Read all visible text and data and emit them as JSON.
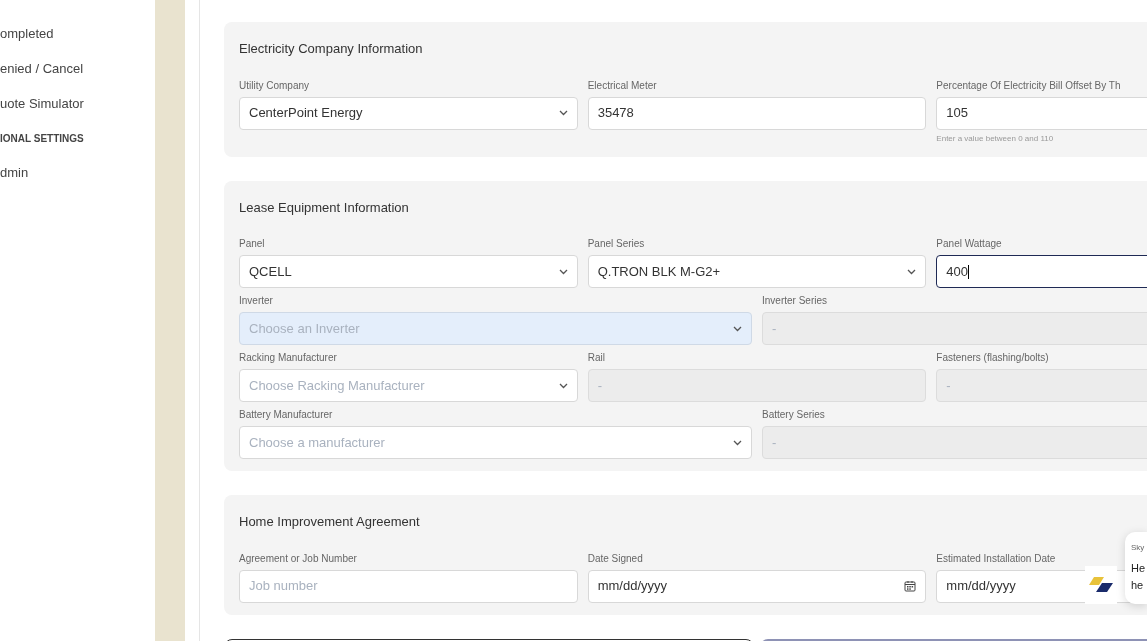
{
  "sidebar": {
    "items": [
      {
        "kind": "item",
        "label": "ompleted"
      },
      {
        "kind": "item",
        "label": "enied / Cancel"
      },
      {
        "kind": "item",
        "label": "uote Simulator"
      },
      {
        "kind": "heading",
        "label": "IONAL SETTINGS"
      },
      {
        "kind": "item",
        "label": "dmin"
      }
    ]
  },
  "sections": [
    {
      "title": "Electricity Company Information",
      "rows": [
        [
          {
            "label": "Utility Company",
            "kind": "select",
            "value": "CenterPoint Energy"
          },
          {
            "label": "Electrical Meter",
            "kind": "text",
            "value": "35478"
          },
          {
            "label": "Percentage Of Electricity Bill Offset By Th",
            "kind": "text",
            "value": "105",
            "hint": "Enter a value between 0 and 110"
          }
        ]
      ]
    },
    {
      "title": "Lease Equipment Information",
      "rows": [
        [
          {
            "label": "Panel",
            "kind": "select",
            "value": "QCELL"
          },
          {
            "label": "Panel Series",
            "kind": "select",
            "value": "Q.TRON BLK M-G2+"
          },
          {
            "label": "Panel Wattage",
            "kind": "text",
            "value": "400",
            "focused": true
          }
        ],
        [
          {
            "label": "Inverter",
            "kind": "select",
            "placeholder": "Choose an Inverter",
            "hovered": true
          },
          {
            "label": "Inverter Series",
            "kind": "readonly",
            "placeholder": "-"
          }
        ],
        [
          {
            "label": "Racking Manufacturer",
            "kind": "select",
            "placeholder": "Choose Racking Manufacturer"
          },
          {
            "label": "Rail",
            "kind": "readonly",
            "placeholder": "-"
          },
          {
            "label": "Fasteners (flashing/bolts)",
            "kind": "readonly",
            "placeholder": "-"
          }
        ],
        [
          {
            "label": "Battery Manufacturer",
            "kind": "select",
            "placeholder": "Choose a manufacturer"
          },
          {
            "label": "Battery Series",
            "kind": "readonly",
            "placeholder": "-"
          }
        ]
      ]
    },
    {
      "title": "Home Improvement Agreement",
      "rows": [
        [
          {
            "label": "Agreement or Job Number",
            "kind": "text",
            "placeholder": "Job number"
          },
          {
            "label": "Date Signed",
            "kind": "date",
            "value": "mm/dd/yyyy"
          },
          {
            "label": "Estimated Installation Date",
            "kind": "date",
            "value": "mm/dd/yyyy"
          }
        ]
      ]
    }
  ],
  "chat": {
    "sender": "Sky",
    "lines": [
      "He",
      "he"
    ]
  }
}
